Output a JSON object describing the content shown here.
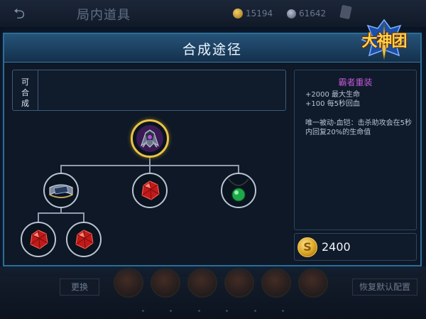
{
  "background": {
    "title": "局内道具",
    "currency_1": "15194",
    "currency_2": "61642",
    "replace_button": "更换",
    "restore_button": "恢复默认配置"
  },
  "logo": {
    "text": "大神团"
  },
  "modal": {
    "title": "合成途径",
    "craftable_label": "可合成"
  },
  "recipe_tree": {
    "root": {
      "icon": "domineering-armor-icon"
    },
    "components": [
      {
        "icon": "armor-bracer-icon",
        "children": [
          "red-crystal-icon",
          "red-crystal-icon"
        ]
      },
      {
        "icon": "red-crystal-icon"
      },
      {
        "icon": "green-pendant-icon"
      }
    ]
  },
  "item": {
    "name": "霸者重装",
    "stats": [
      "+2000 最大生命",
      "+100 每5秒回血"
    ],
    "passive": "唯一被动-血铠：击杀助攻会在5秒内回复20%的生命值",
    "price": "2400",
    "name_color": "#c45ad8"
  }
}
